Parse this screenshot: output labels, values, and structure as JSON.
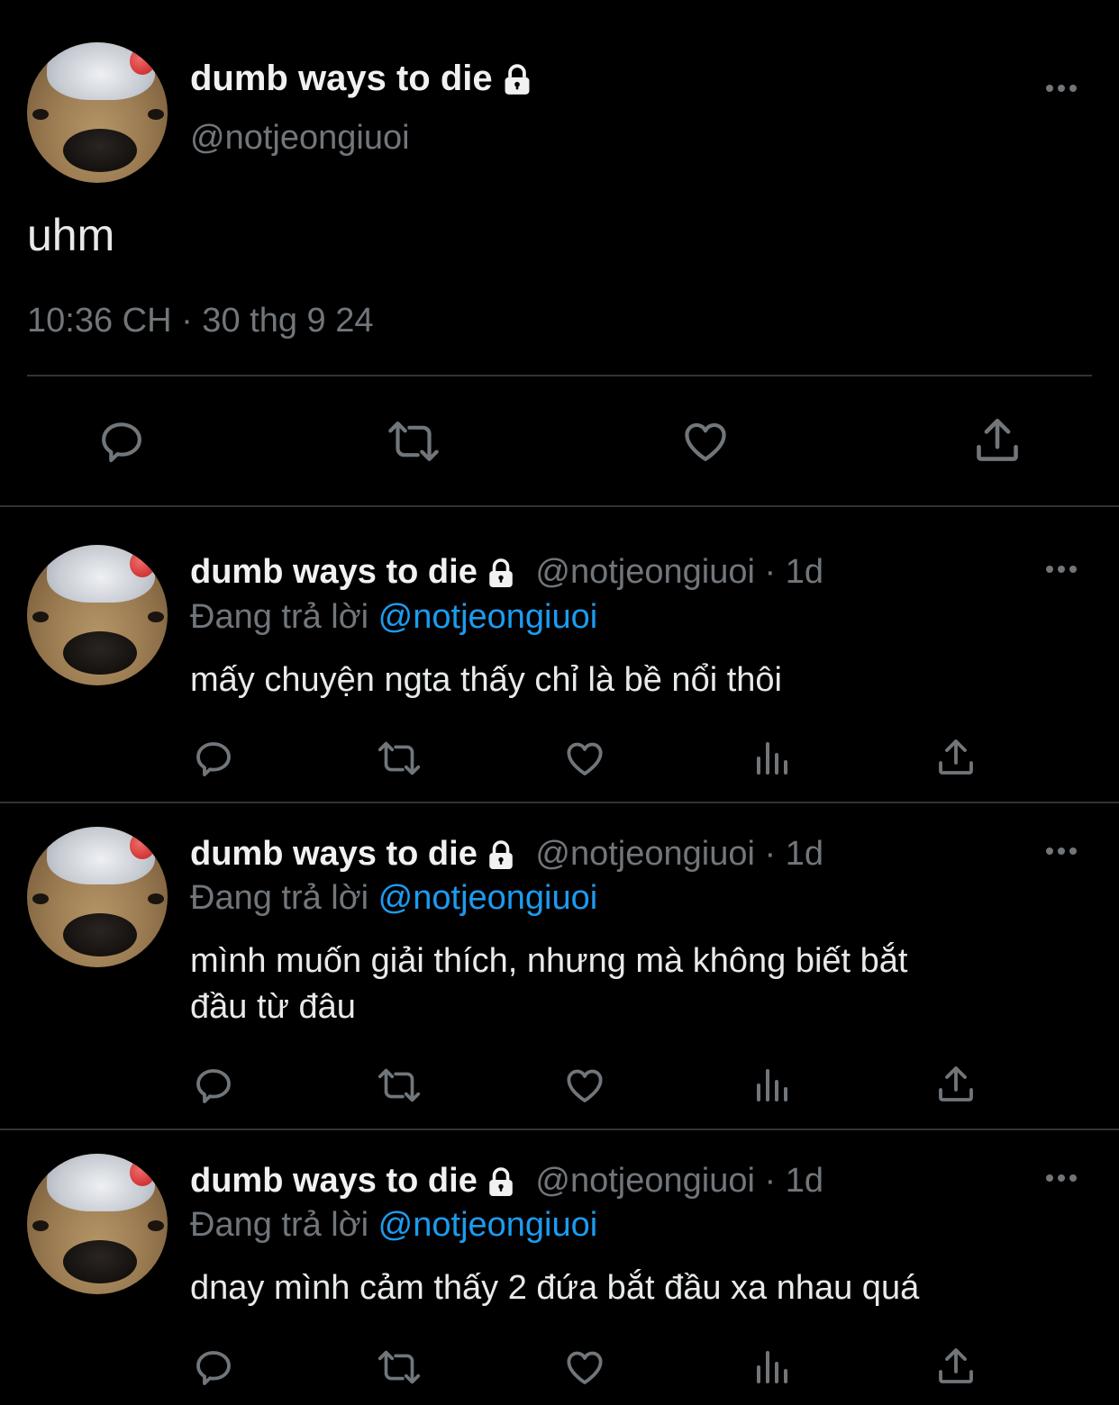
{
  "main_tweet": {
    "display_name": "dumb ways to die",
    "handle": "@notjeongiuoi",
    "text": "uhm",
    "timestamp": "10:36 CH · 30 thg 9 24"
  },
  "replies": [
    {
      "display_name": "dumb ways to die",
      "handle": "@notjeongiuoi",
      "time": "· 1d",
      "replying_label": "Đang trả lời",
      "replying_to": "@notjeongiuoi",
      "text_lines": [
        "mấy chuyện ngta thấy chỉ là bề nổi thôi"
      ]
    },
    {
      "display_name": "dumb ways to die",
      "handle": "@notjeongiuoi",
      "time": "· 1d",
      "replying_label": "Đang trả lời",
      "replying_to": "@notjeongiuoi",
      "text_lines": [
        "mình muốn giải thích, nhưng mà không biết bắt",
        "đầu từ đâu"
      ]
    },
    {
      "display_name": "dumb ways to die",
      "handle": "@notjeongiuoi",
      "time": "· 1d",
      "replying_label": "Đang trả lời",
      "replying_to": "@notjeongiuoi",
      "text_lines": [
        "dnay mình cảm thấy 2 đứa bắt đầu xa nhau quá"
      ]
    }
  ],
  "icons": {
    "reply": "speech-bubble-icon",
    "retweet": "retweet-icon",
    "like": "heart-icon",
    "views": "bar-chart-icon",
    "share": "share-upload-icon",
    "more": "more-dots-icon",
    "lock": "lock-icon"
  },
  "colors": {
    "background": "#000000",
    "text": "#e7e9ea",
    "secondary": "#71767b",
    "link": "#1d9bf0",
    "divider": "#2f3336"
  }
}
